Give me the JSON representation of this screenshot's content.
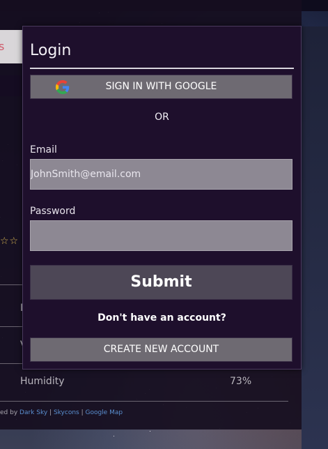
{
  "background_app": {
    "tab_fragment": "s",
    "rating_stars": "☆☆",
    "row_letters": [
      "I",
      "V"
    ],
    "humidity": {
      "label": "Humidity",
      "value": "73%"
    },
    "footer": {
      "prefix": "ed by ",
      "links": [
        "Dark Sky",
        "Skycons",
        "Google Map"
      ],
      "separator": " | "
    }
  },
  "login": {
    "title": "Login",
    "google_button": {
      "label": "SIGN IN WITH GOOGLE",
      "icon": "google-g-icon"
    },
    "or_text": "OR",
    "email": {
      "label": "Email",
      "value": "",
      "placeholder": "JohnSmith@email.com"
    },
    "password": {
      "label": "Password",
      "value": "",
      "placeholder": ""
    },
    "submit_label": "Submit",
    "no_account_text": "Don't have an account?",
    "create_account_label": "CREATE NEW ACCOUNT"
  },
  "colors": {
    "modal_bg": "#1e0f2c",
    "button_bg": "#6e6a72",
    "submit_bg": "#4d4756",
    "input_bg": "#8d8893",
    "link": "#5a8fd0",
    "star": "#d6b451"
  }
}
